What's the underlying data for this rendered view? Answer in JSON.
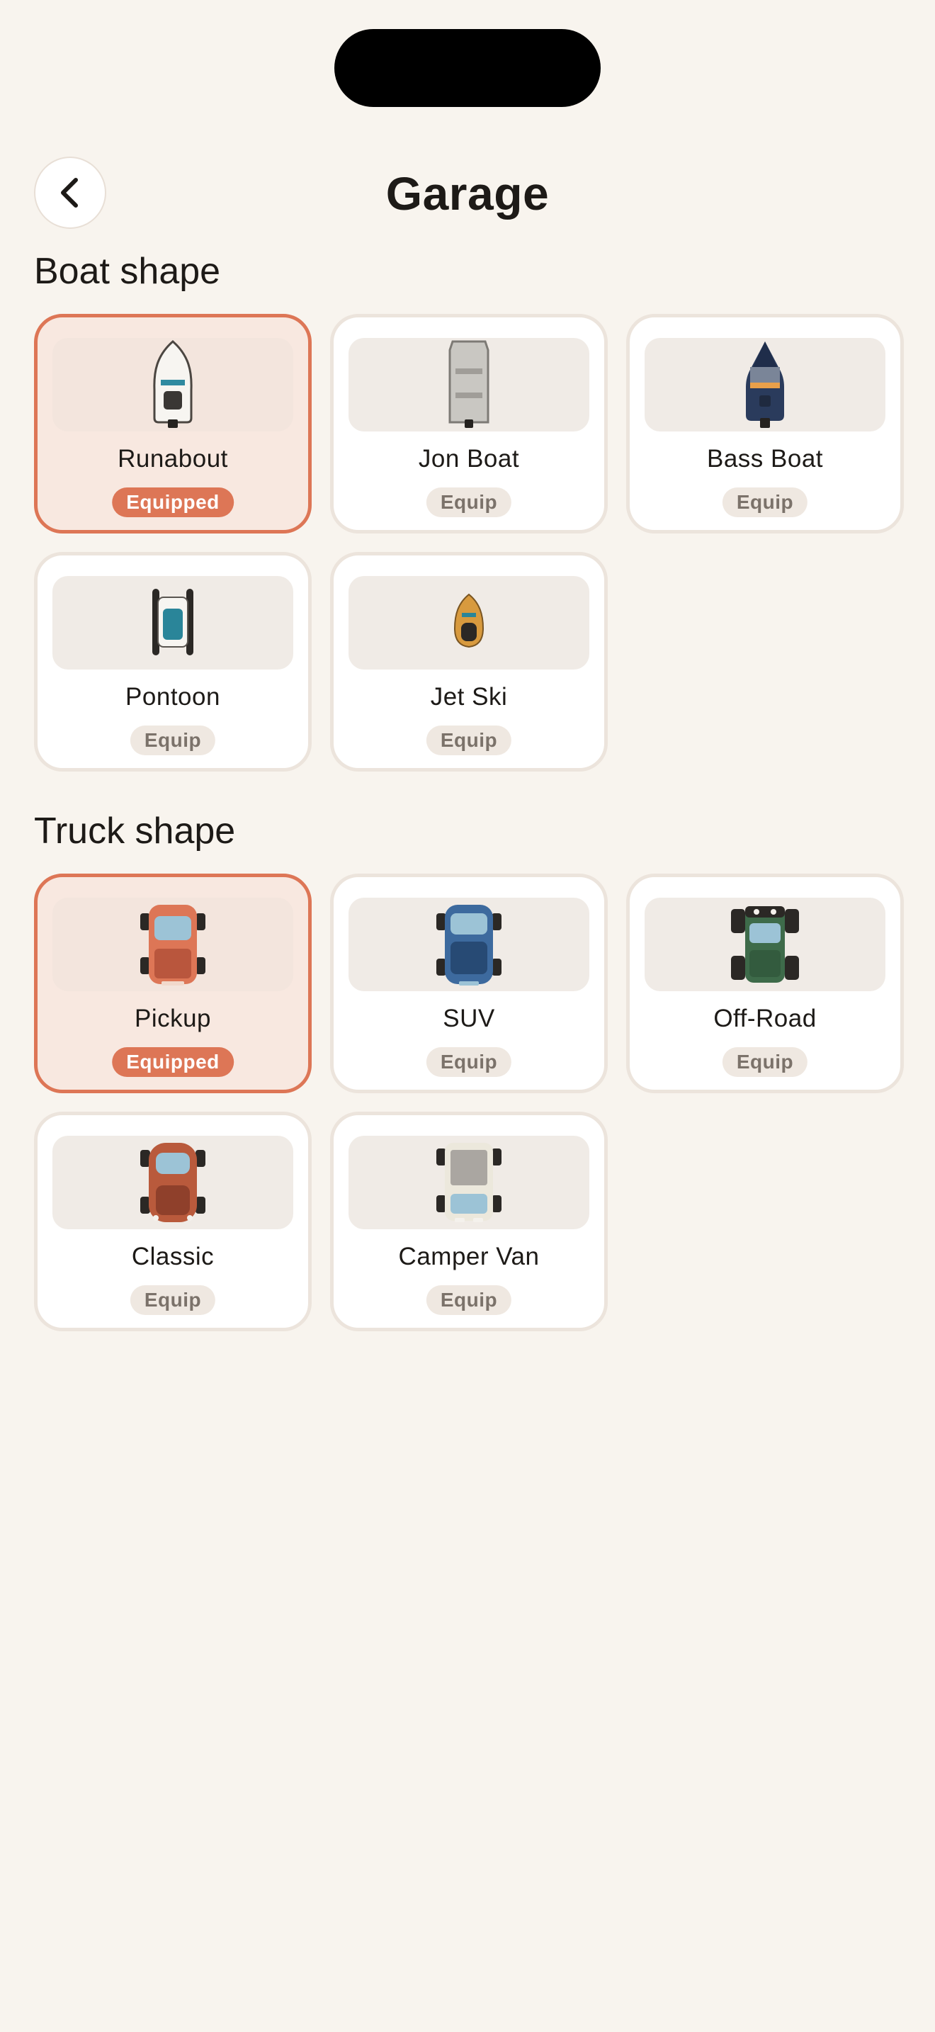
{
  "header": {
    "title": "Garage",
    "back_icon": "chevron-left-icon"
  },
  "colors": {
    "accent": "#dd7656",
    "background": "#f8f4ee",
    "card": "#ffffff",
    "thumb": "#f0ebe6"
  },
  "sections": [
    {
      "title": "Boat shape",
      "items": [
        {
          "name": "Runabout",
          "action": "Equipped",
          "equipped": true,
          "icon": "runabout-boat-icon"
        },
        {
          "name": "Jon Boat",
          "action": "Equip",
          "equipped": false,
          "icon": "jon-boat-icon"
        },
        {
          "name": "Bass Boat",
          "action": "Equip",
          "equipped": false,
          "icon": "bass-boat-icon"
        },
        {
          "name": "Pontoon",
          "action": "Equip",
          "equipped": false,
          "icon": "pontoon-boat-icon"
        },
        {
          "name": "Jet Ski",
          "action": "Equip",
          "equipped": false,
          "icon": "jet-ski-icon"
        }
      ]
    },
    {
      "title": "Truck shape",
      "items": [
        {
          "name": "Pickup",
          "action": "Equipped",
          "equipped": true,
          "icon": "pickup-truck-icon"
        },
        {
          "name": "SUV",
          "action": "Equip",
          "equipped": false,
          "icon": "suv-icon"
        },
        {
          "name": "Off-Road",
          "action": "Equip",
          "equipped": false,
          "icon": "off-road-truck-icon"
        },
        {
          "name": "Classic",
          "action": "Equip",
          "equipped": false,
          "icon": "classic-car-icon"
        },
        {
          "name": "Camper Van",
          "action": "Equip",
          "equipped": false,
          "icon": "camper-van-icon"
        }
      ]
    }
  ]
}
